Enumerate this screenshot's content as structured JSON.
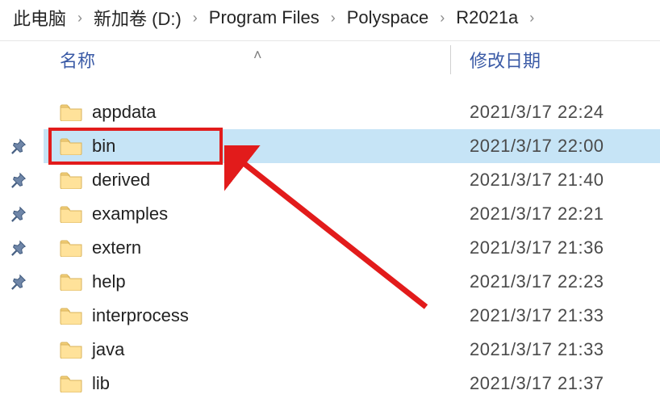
{
  "breadcrumb": [
    "此电脑",
    "新加卷 (D:)",
    "Program Files",
    "Polyspace",
    "R2021a"
  ],
  "columns": {
    "name": "名称",
    "modified": "修改日期"
  },
  "rows": [
    {
      "name": "appdata",
      "modified": "2021/3/17 22:24",
      "pinned": false,
      "selected": false
    },
    {
      "name": "bin",
      "modified": "2021/3/17 22:00",
      "pinned": true,
      "selected": true
    },
    {
      "name": "derived",
      "modified": "2021/3/17 21:40",
      "pinned": true,
      "selected": false
    },
    {
      "name": "examples",
      "modified": "2021/3/17 22:21",
      "pinned": true,
      "selected": false
    },
    {
      "name": "extern",
      "modified": "2021/3/17 21:36",
      "pinned": true,
      "selected": false
    },
    {
      "name": "help",
      "modified": "2021/3/17 22:23",
      "pinned": true,
      "selected": false
    },
    {
      "name": "interprocess",
      "modified": "2021/3/17 21:33",
      "pinned": false,
      "selected": false
    },
    {
      "name": "java",
      "modified": "2021/3/17 21:33",
      "pinned": false,
      "selected": false
    },
    {
      "name": "lib",
      "modified": "2021/3/17 21:37",
      "pinned": false,
      "selected": false
    }
  ],
  "annotation": {
    "highlight_row_index": 1,
    "highlight_box_css": "left:6px; top:108px; width:216px; height:46px;",
    "arrow_css": "left:224px; top:130px; width:260px; height:210px;"
  }
}
